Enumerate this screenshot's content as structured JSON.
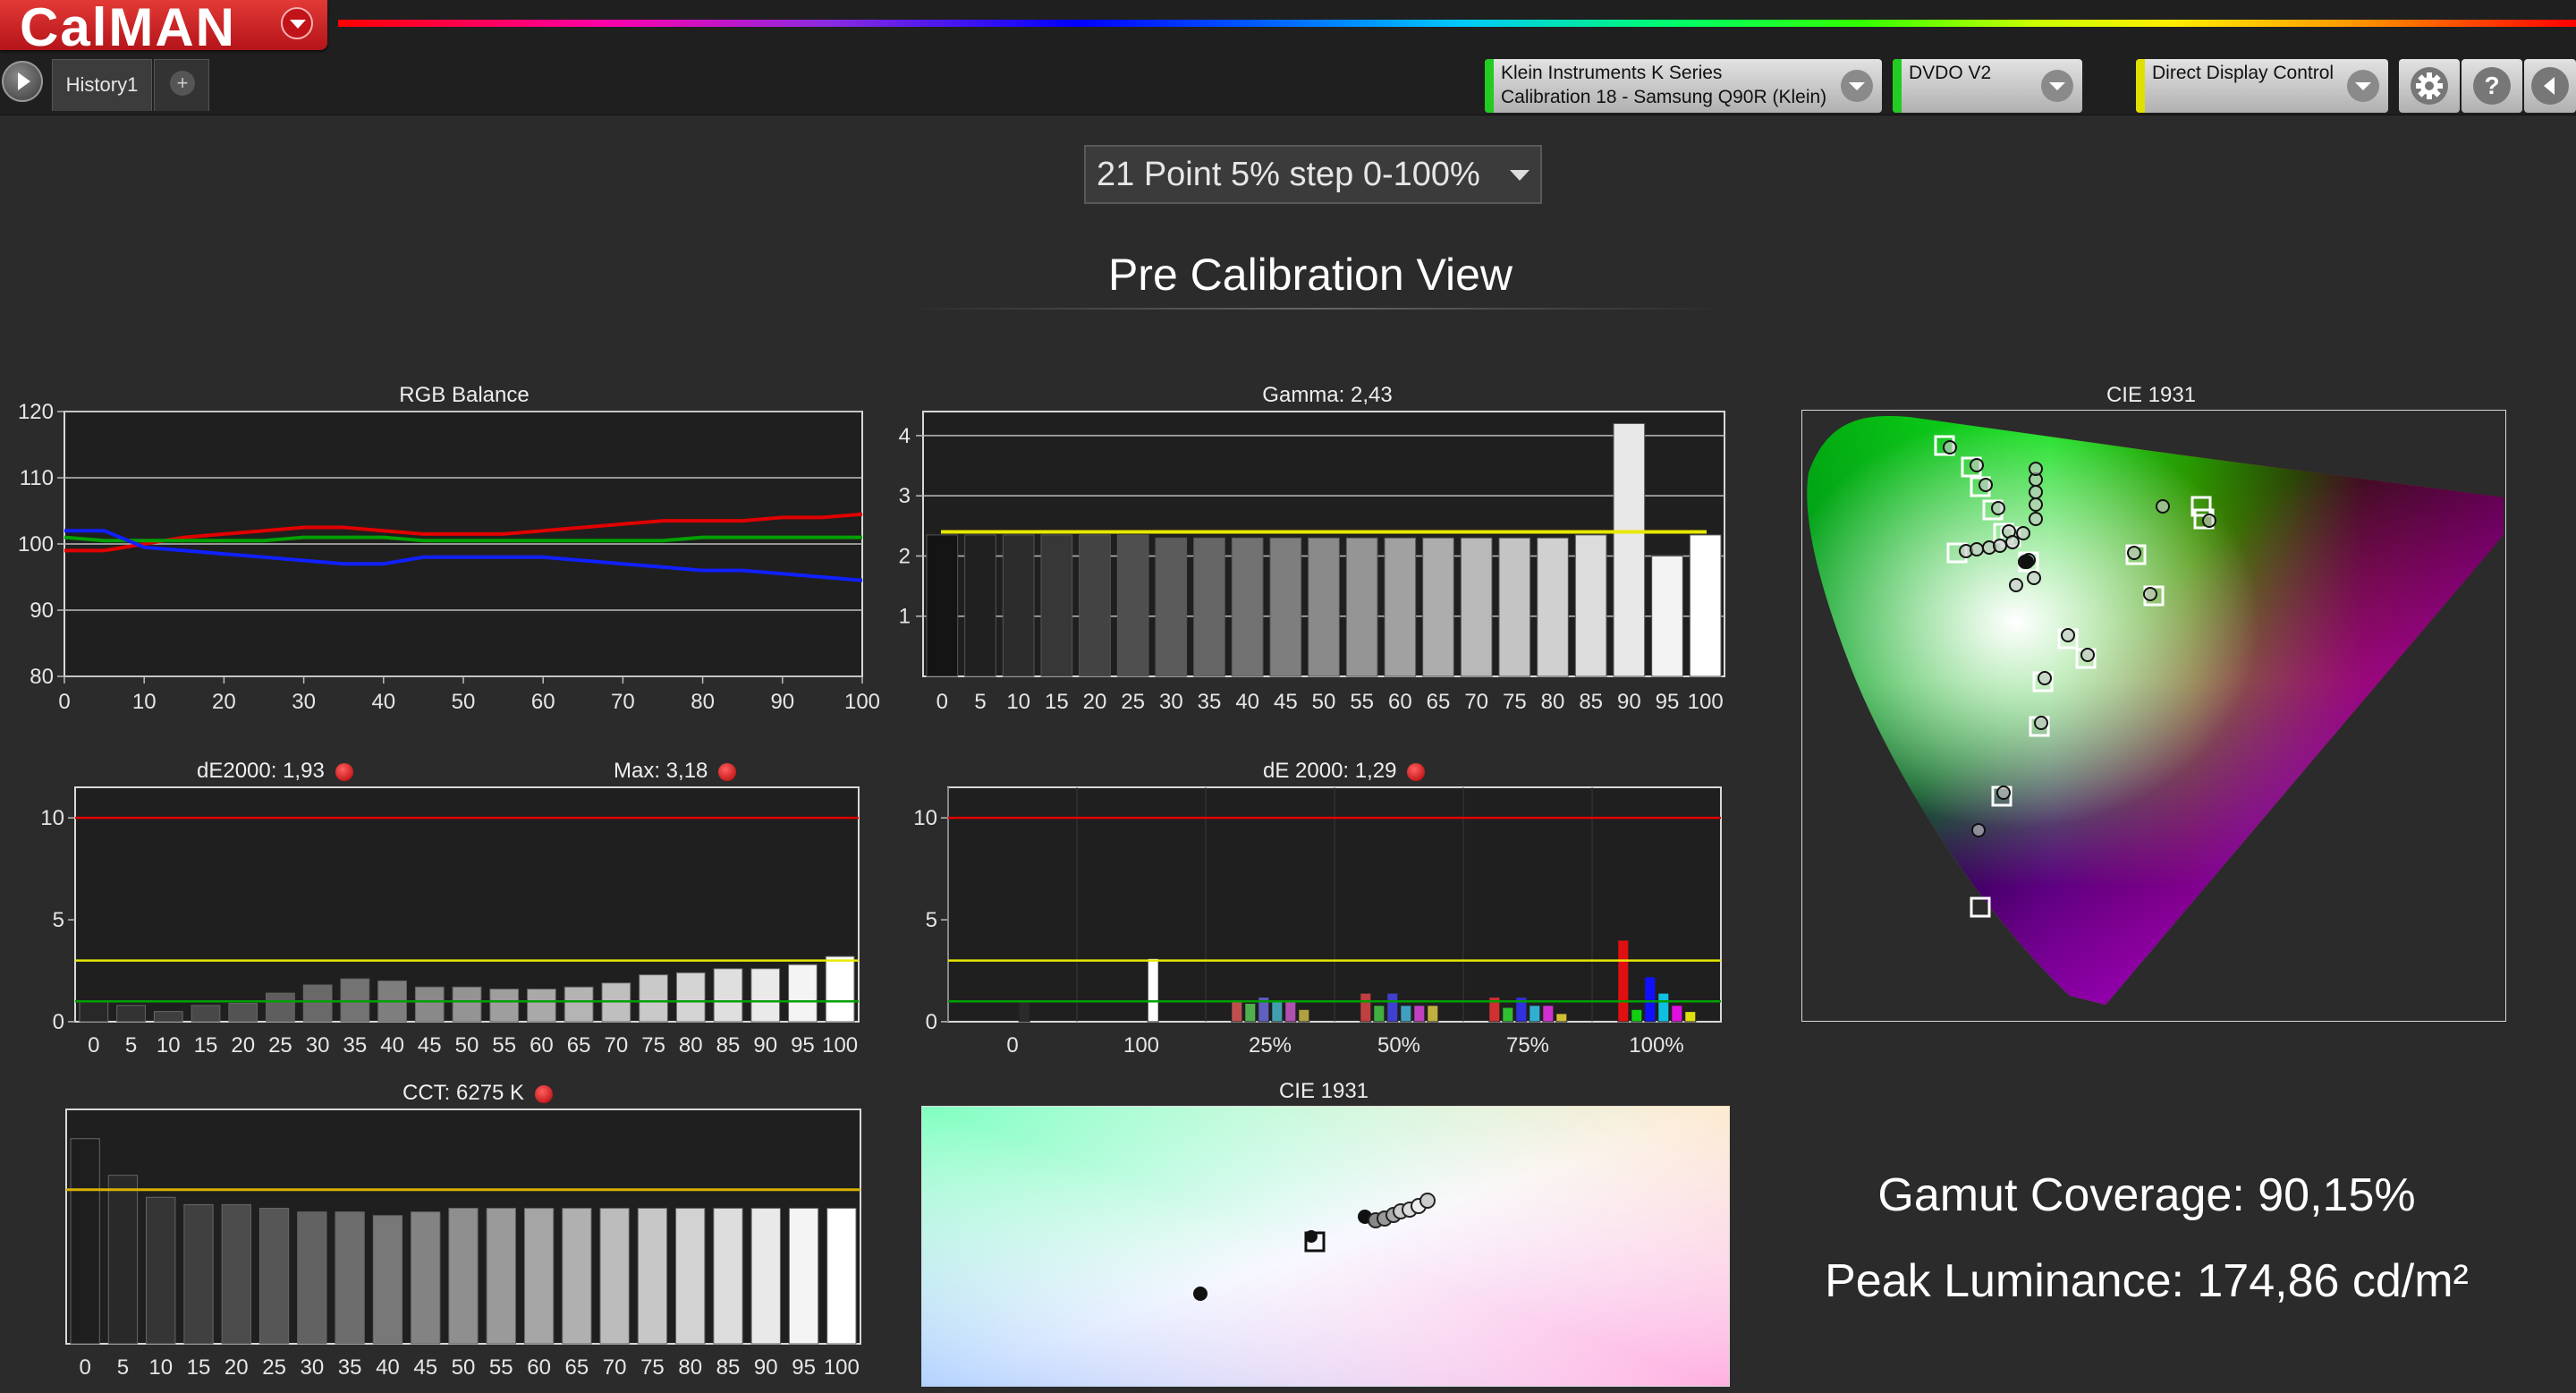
{
  "app": {
    "logo": "CalMAN"
  },
  "tabs": [
    {
      "label": "History1"
    },
    {
      "label": "+"
    }
  ],
  "devices": [
    {
      "line1": "Klein Instruments K Series",
      "line2": "Calibration 18 - Samsung Q90R (Klein)",
      "stripe": "#22cc22"
    },
    {
      "line1": "DVDO V2",
      "line2": "",
      "stripe": "#22cc22"
    },
    {
      "line1": "Direct Display Control",
      "line2": "",
      "stripe": "#e0e000"
    }
  ],
  "toolbar": {
    "settings_icon": "gear-icon",
    "help_label": "?",
    "collapse_icon": "chevron-left-icon"
  },
  "step_selector": {
    "value": "21 Point 5% step 0-100%"
  },
  "page_title": "Pre Calibration View",
  "charts": {
    "rgb_balance": {
      "title": "RGB Balance",
      "x_ticks": [
        "0",
        "10",
        "20",
        "30",
        "40",
        "50",
        "60",
        "70",
        "80",
        "90",
        "100"
      ],
      "y_ticks": [
        "120",
        "110",
        "100",
        "90",
        "80"
      ]
    },
    "gamma": {
      "title": "Gamma: 2,43",
      "y_ticks": [
        "4",
        "3",
        "2",
        "1"
      ],
      "x_ticks": [
        "0",
        "5",
        "10",
        "15",
        "20",
        "25",
        "30",
        "35",
        "40",
        "45",
        "50",
        "55",
        "60",
        "65",
        "70",
        "75",
        "80",
        "85",
        "90",
        "95",
        "100"
      ]
    },
    "cie_top": {
      "title": "CIE 1931"
    },
    "de_grayscale": {
      "title": "dE2000:  1,93",
      "max_label": "Max: 3,18",
      "y_ticks": [
        "10",
        "5",
        "0"
      ],
      "x_ticks": [
        "0",
        "5",
        "10",
        "15",
        "20",
        "25",
        "30",
        "35",
        "40",
        "45",
        "50",
        "55",
        "60",
        "65",
        "70",
        "75",
        "80",
        "85",
        "90",
        "95",
        "100"
      ]
    },
    "de_color": {
      "title": "dE 2000: 1,29",
      "y_ticks": [
        "10",
        "5",
        "0"
      ],
      "x_ticks": [
        "0",
        "100",
        "25%",
        "50%",
        "75%",
        "100%"
      ]
    },
    "cct": {
      "title": "CCT: 6275 K"
    },
    "cie_bottom": {
      "title": "CIE 1931"
    }
  },
  "stats": {
    "gamut": "Gamut Coverage: 90,15%",
    "peak": "Peak Luminance: 174,86 cd/m²"
  },
  "colors": {
    "red": "#e00000",
    "green": "#00a000",
    "blue": "#1020ff",
    "yellow": "#e8e800",
    "brand": "#c8161d"
  },
  "chart_data": [
    {
      "id": "rgb_balance",
      "type": "line",
      "title": "RGB Balance",
      "x": [
        0,
        5,
        10,
        15,
        20,
        25,
        30,
        35,
        40,
        45,
        50,
        55,
        60,
        65,
        70,
        75,
        80,
        85,
        90,
        95,
        100
      ],
      "xlim": [
        0,
        100
      ],
      "ylim": [
        80,
        120
      ],
      "series": [
        {
          "color": "#e00000",
          "values": [
            99,
            99,
            100,
            101,
            101.5,
            102,
            102.5,
            102.5,
            102,
            101.5,
            101.5,
            101.5,
            102,
            102.5,
            103,
            103.5,
            103.5,
            103.5,
            104,
            104,
            104.5
          ]
        },
        {
          "color": "#00a000",
          "values": [
            101,
            100.5,
            100.5,
            100.5,
            100.5,
            100.5,
            101,
            101,
            101,
            100.5,
            100.5,
            100.5,
            100.5,
            100.5,
            100.5,
            100.5,
            101,
            101,
            101,
            101,
            101
          ]
        },
        {
          "color": "#1020ff",
          "values": [
            102,
            102,
            99.5,
            99,
            98.5,
            98,
            97.5,
            97,
            97,
            98,
            98,
            98,
            98,
            97.5,
            97,
            96.5,
            96,
            96,
            95.5,
            95,
            94.5
          ]
        }
      ]
    },
    {
      "id": "gamma",
      "type": "bar",
      "title": "Gamma: 2,43",
      "categories": [
        "0",
        "5",
        "10",
        "15",
        "20",
        "25",
        "30",
        "35",
        "40",
        "45",
        "50",
        "55",
        "60",
        "65",
        "70",
        "75",
        "80",
        "85",
        "90",
        "95",
        "100"
      ],
      "values": [
        2.35,
        2.35,
        2.35,
        2.35,
        2.35,
        2.35,
        2.3,
        2.3,
        2.3,
        2.3,
        2.3,
        2.3,
        2.3,
        2.3,
        2.3,
        2.3,
        2.3,
        2.35,
        4.2,
        2.0,
        2.35
      ],
      "target": 2.4,
      "ylim": [
        0,
        4.4
      ]
    },
    {
      "id": "de_grayscale",
      "type": "bar",
      "title": "dE2000:  1,93",
      "categories": [
        "0",
        "5",
        "10",
        "15",
        "20",
        "25",
        "30",
        "35",
        "40",
        "45",
        "50",
        "55",
        "60",
        "65",
        "70",
        "75",
        "80",
        "85",
        "90",
        "95",
        "100"
      ],
      "values": [
        1.0,
        0.8,
        0.5,
        0.8,
        0.9,
        1.4,
        1.8,
        2.1,
        2.0,
        1.7,
        1.7,
        1.6,
        1.6,
        1.7,
        1.9,
        2.3,
        2.4,
        2.6,
        2.6,
        2.8,
        3.2
      ],
      "thresholds": [
        10,
        3,
        1
      ],
      "ylim": [
        0,
        11.5
      ]
    },
    {
      "id": "de_color",
      "type": "bar",
      "title": "dE 2000: 1,29",
      "groups": [
        {
          "label": "0",
          "values": [
            {
              "c": "#2a2a2a",
              "v": 1.0
            }
          ]
        },
        {
          "label": "100",
          "values": [
            {
              "c": "#ffffff",
              "v": 3.1
            }
          ]
        },
        {
          "label": "25%",
          "values": [
            {
              "c": "#c05050",
              "v": 1.0
            },
            {
              "c": "#50b050",
              "v": 0.9
            },
            {
              "c": "#6060c0",
              "v": 1.2
            },
            {
              "c": "#40a0b0",
              "v": 1.0
            },
            {
              "c": "#b050b0",
              "v": 1.0
            },
            {
              "c": "#b0a040",
              "v": 0.6
            }
          ]
        },
        {
          "label": "50%",
          "values": [
            {
              "c": "#c04040",
              "v": 1.4
            },
            {
              "c": "#40b040",
              "v": 0.8
            },
            {
              "c": "#4040d0",
              "v": 1.4
            },
            {
              "c": "#40a0c0",
              "v": 0.8
            },
            {
              "c": "#c040c0",
              "v": 0.8
            },
            {
              "c": "#c0b040",
              "v": 0.8
            }
          ]
        },
        {
          "label": "75%",
          "values": [
            {
              "c": "#d03030",
              "v": 1.2
            },
            {
              "c": "#30c030",
              "v": 0.7
            },
            {
              "c": "#3030e0",
              "v": 1.2
            },
            {
              "c": "#30b0d0",
              "v": 0.8
            },
            {
              "c": "#d030d0",
              "v": 0.8
            },
            {
              "c": "#d0c030",
              "v": 0.4
            }
          ]
        },
        {
          "label": "100%",
          "values": [
            {
              "c": "#e01010",
              "v": 4.0
            },
            {
              "c": "#10d010",
              "v": 0.6
            },
            {
              "c": "#1010ff",
              "v": 2.2
            },
            {
              "c": "#10c0e0",
              "v": 1.4
            },
            {
              "c": "#e010e0",
              "v": 0.8
            },
            {
              "c": "#e0e010",
              "v": 0.5
            }
          ]
        }
      ],
      "thresholds": [
        10,
        3,
        1
      ],
      "ylim": [
        0,
        11.5
      ]
    },
    {
      "id": "cct",
      "type": "bar",
      "title": "CCT: 6275 K",
      "categories": [
        "0",
        "5",
        "10",
        "15",
        "20",
        "25",
        "30",
        "35",
        "40",
        "45",
        "50",
        "55",
        "60",
        "65",
        "70",
        "75",
        "80",
        "85",
        "90",
        "95",
        "100"
      ],
      "values": [
        7200,
        6700,
        6400,
        6300,
        6300,
        6250,
        6200,
        6200,
        6150,
        6200,
        6250,
        6250,
        6250,
        6250,
        6250,
        6250,
        6250,
        6250,
        6250,
        6250,
        6250
      ],
      "target": 6504,
      "ylim": [
        4400,
        7600
      ]
    }
  ]
}
